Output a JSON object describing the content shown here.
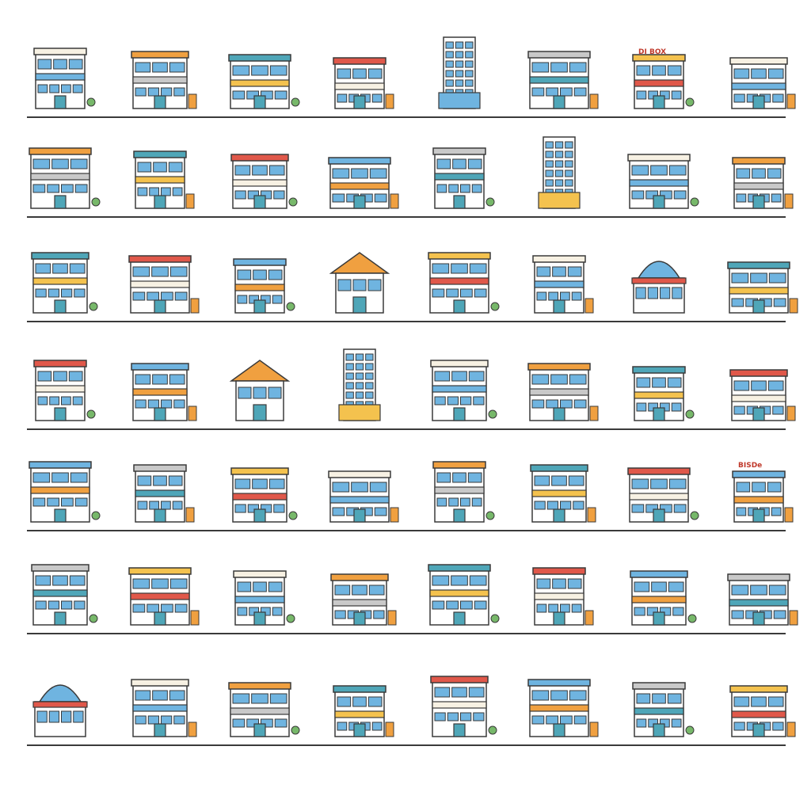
{
  "sheet": {
    "kind": "storefront building icon grid",
    "captions_legible": false,
    "palette": {
      "outline": "#3a3a3a",
      "red": "#e0584a",
      "orange": "#f0a040",
      "yellow": "#f4c24e",
      "blue": "#6fb4e0",
      "teal": "#4fa6b8",
      "green": "#77b86a",
      "cream": "#f7f1e3",
      "gray": "#c9c9c9",
      "white": "#ffffff"
    },
    "sign_texts": [
      "DI BOX",
      "BISDe"
    ],
    "rows": [
      {
        "caption_placeholders": [
          "",
          "",
          "",
          "",
          "",
          "",
          "",
          ""
        ],
        "icons": [
          "shop-building-icon",
          "shop-building-icon",
          "shop-building-icon",
          "shop-building-icon",
          "tower-building-icon",
          "shop-building-icon",
          "shop-building-icon",
          "shop-building-icon"
        ]
      },
      {
        "caption_placeholders": [
          "",
          "",
          "",
          "",
          "",
          "",
          "",
          ""
        ],
        "icons": [
          "shop-building-icon",
          "shop-building-icon",
          "shop-building-icon",
          "shop-building-icon",
          "shop-building-icon",
          "tower-building-icon",
          "shop-building-icon",
          "shop-building-icon"
        ]
      },
      {
        "caption_placeholders": [
          "",
          "",
          "",
          "",
          "",
          "",
          "",
          ""
        ],
        "icons": [
          "shop-building-icon",
          "shop-building-icon",
          "shop-building-icon",
          "house-building-icon",
          "shop-building-icon",
          "shop-building-icon",
          "dome-building-icon",
          "shop-building-icon"
        ]
      },
      {
        "caption_placeholders": [
          "",
          "",
          "",
          "",
          "",
          "",
          "",
          ""
        ],
        "icons": [
          "shop-building-icon",
          "shop-building-icon",
          "house-building-icon",
          "tower-building-icon",
          "shop-building-icon",
          "shop-building-icon",
          "shop-building-icon",
          "shop-building-icon"
        ]
      },
      {
        "caption_placeholders": [
          "",
          "",
          "",
          "",
          "",
          "",
          "",
          ""
        ],
        "icons": [
          "shop-building-icon",
          "shop-building-icon",
          "shop-building-icon",
          "shop-building-icon",
          "shop-building-icon",
          "shop-building-icon",
          "shop-building-icon",
          "shop-building-icon"
        ]
      },
      {
        "caption_placeholders": [
          "",
          "",
          "",
          "",
          "",
          "",
          "",
          ""
        ],
        "icons": [
          "shop-building-icon",
          "shop-building-icon",
          "shop-building-icon",
          "shop-building-icon",
          "shop-building-icon",
          "shop-building-icon",
          "shop-building-icon",
          "shop-building-icon"
        ]
      },
      {
        "caption_placeholders": [
          "",
          "",
          "",
          "",
          "",
          "",
          "",
          ""
        ],
        "icons": [
          "dome-building-icon",
          "shop-building-icon",
          "shop-building-icon",
          "shop-building-icon",
          "shop-building-icon",
          "shop-building-icon",
          "shop-building-icon",
          "shop-building-icon"
        ]
      }
    ]
  }
}
